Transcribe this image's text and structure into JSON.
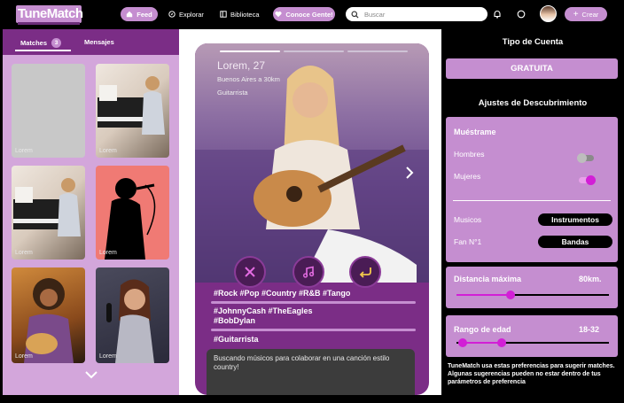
{
  "header": {
    "logo": "TuneMatch",
    "nav": {
      "feed": "Feed",
      "explorar": "Explorar",
      "biblioteca": "Biblioteca",
      "conoce": "Conoce Gente!"
    },
    "search_placeholder": "Buscar",
    "create_label": "Crear"
  },
  "left": {
    "tabs": {
      "matches": "Matches",
      "matches_count": "3",
      "mensajes": "Mensajes"
    },
    "caption": "Lorem"
  },
  "profile": {
    "name": "Lorem, 27",
    "location": "Buenos Aires a 30km",
    "instrument": "Guitarrista",
    "tags_genres": "#Rock #Pop #Country #R&B #Tango",
    "tags_artists": "#JohnnyCash #TheEagles #BobDylan",
    "tags_role": "#Guitarrista",
    "bio": "Buscando músicos para colaborar en una canción estilo country!"
  },
  "settings": {
    "account_title": "Tipo de Cuenta",
    "account_type": "GRATUITA",
    "discovery_title": "Ajustes de Descubrimiento",
    "show_me": "Muéstrame",
    "hombres": "Hombres",
    "hombres_on": false,
    "mujeres": "Mujeres",
    "mujeres_on": true,
    "musicos_label": "Musicos",
    "musicos_value": "Instrumentos",
    "fan_label": "Fan N°1",
    "fan_value": "Bandas",
    "distance_label": "Distancia máxima",
    "distance_value": "80km.",
    "age_label": "Rango de edad",
    "age_value": "18-32",
    "age_min": 18,
    "age_max": 32,
    "note": "TuneMatch usa estas preferencias para sugerir matches. Algunas sugerencias pueden no estar dentro de tus parámetros de preferencia"
  },
  "colors": {
    "accent": "#c58ed0",
    "primary": "#7b2d86",
    "slider": "#d21fd6"
  }
}
